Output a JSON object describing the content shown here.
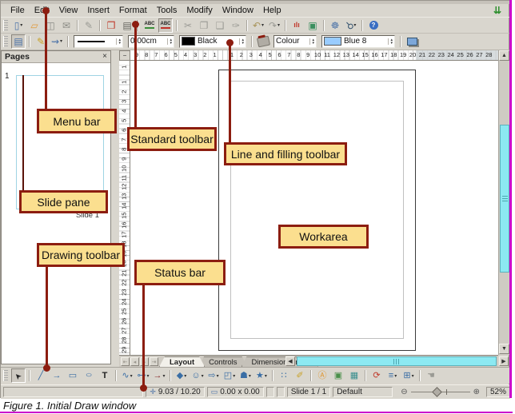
{
  "colors": {
    "callout_fill": "#fbdf8f",
    "callout_border": "#8c1d10",
    "scrollbar_thumb": "#8ce9f2",
    "figure_border": "#cc00cc"
  },
  "menu_bar": {
    "items": [
      "File",
      "Edit",
      "View",
      "Insert",
      "Format",
      "Tools",
      "Modify",
      "Window",
      "Help"
    ],
    "update_icon_glyph": "⇊"
  },
  "standard_toolbar": {
    "icons": [
      {
        "name": "new-icon",
        "glyph": "▯",
        "color": "#4a72a8",
        "dd": true
      },
      {
        "name": "open-icon",
        "glyph": "▱",
        "color": "#e09a3a"
      },
      {
        "name": "save-icon",
        "glyph": "◫",
        "color": "#8a8a84"
      },
      {
        "name": "email-icon",
        "glyph": "✉",
        "color": "#8a8a84"
      },
      {
        "sep": true
      },
      {
        "name": "edit-file-icon",
        "glyph": "✎",
        "color": "#9a9a94"
      },
      {
        "sep": true
      },
      {
        "name": "export-pdf-icon",
        "glyph": "❒",
        "color": "#c0392b"
      },
      {
        "name": "print-icon",
        "glyph": "▤",
        "color": "#666660"
      },
      {
        "sep": true
      },
      {
        "name": "spellcheck-icon",
        "cls": "abc abc1"
      },
      {
        "name": "autospellcheck-icon",
        "cls": "abc abc2",
        "pressed": true
      },
      {
        "sep": true
      },
      {
        "name": "cut-icon",
        "glyph": "✂",
        "color": "#9a9a94"
      },
      {
        "name": "copy-icon",
        "glyph": "❐",
        "color": "#9a9a94"
      },
      {
        "name": "paste-icon",
        "glyph": "❑",
        "color": "#9a9a94"
      },
      {
        "name": "format-paintbrush-icon",
        "glyph": "✑",
        "color": "#9a9a94"
      },
      {
        "sep": true
      },
      {
        "name": "undo-icon",
        "glyph": "↶",
        "color": "#a8945a",
        "dd": true
      },
      {
        "name": "redo-icon",
        "glyph": "↷",
        "color": "#9a9a94",
        "dd": true
      },
      {
        "sep": true
      },
      {
        "name": "chart-icon",
        "glyph": "ılı",
        "cls": "chart",
        "color": "#c0392b"
      },
      {
        "name": "gallery-icon",
        "glyph": "▣",
        "color": "#3a8f5f"
      },
      {
        "sep": true
      },
      {
        "name": "navigator-icon",
        "glyph": "☸",
        "color": "#4a72a8"
      },
      {
        "name": "zoom-icon",
        "glyph": "⚲",
        "cls": "rot",
        "color": "#33526e",
        "dd": true
      },
      {
        "sep": true
      },
      {
        "name": "help-icon",
        "cls": "helpico"
      }
    ]
  },
  "line_filling_toolbar": {
    "left_icons": [
      {
        "name": "styles-formatting-icon",
        "glyph": "▤",
        "color": "#4a72a8",
        "pressed": true
      },
      {
        "sep": true
      },
      {
        "name": "line-properties-icon",
        "glyph": "✎",
        "color": "#c9a227"
      },
      {
        "name": "arrow-style-icon",
        "glyph": "⇝",
        "color": "#4a72a8",
        "dd": true
      },
      {
        "sep": true
      }
    ],
    "line_width_value": "0.00cm",
    "line_color_name": "Black",
    "line_color_hex": "#000000",
    "fill_type": "Colour",
    "fill_color_name": "Blue 8",
    "fill_color_hex": "#99ccff"
  },
  "pages_panel": {
    "title": "Pages",
    "close_glyph": "×",
    "slide_number": "1",
    "slide_name": "Slide 1"
  },
  "rulers": {
    "horizontal_left": [
      "9",
      "8",
      "7",
      "6",
      "5",
      "4",
      "3",
      "2",
      "1"
    ],
    "horizontal_right": [
      "1",
      "2",
      "3",
      "4",
      "5",
      "6",
      "7",
      "8",
      "9",
      "10",
      "11",
      "12",
      "13",
      "14",
      "15",
      "16",
      "17",
      "18",
      "19",
      "20",
      "21",
      "22",
      "23",
      "24",
      "25",
      "26",
      "27",
      "28"
    ],
    "vertical_top": [
      "1"
    ],
    "vertical_main": [
      "1",
      "2",
      "3",
      "4",
      "5",
      "6",
      "7",
      "8",
      "9",
      "10",
      "11",
      "12",
      "13",
      "14",
      "15",
      "16",
      "17",
      "18",
      "19",
      "20",
      "21",
      "22",
      "23",
      "24",
      "25",
      "26",
      "27",
      "28",
      "29"
    ]
  },
  "tab_bar": {
    "nav": [
      {
        "name": "first-slide-button",
        "glyph": "⇤",
        "color": "#9a968e"
      },
      {
        "name": "prev-slide-button",
        "glyph": "◂",
        "color": "#9a968e"
      },
      {
        "name": "next-slide-button",
        "glyph": "▸",
        "color": "#9a968e"
      },
      {
        "name": "last-slide-button",
        "glyph": "⇥",
        "color": "#9a968e"
      }
    ],
    "tabs": [
      {
        "label": "Layout",
        "active": true
      },
      {
        "label": "Controls",
        "active": false
      },
      {
        "label": "Dimension Lines",
        "active": false
      }
    ]
  },
  "drawing_toolbar": {
    "icons": [
      {
        "name": "select-icon",
        "glyph": "➤",
        "cls": "rotm",
        "color": "#222222",
        "pressed": true
      },
      {
        "sep": true
      },
      {
        "name": "line-icon",
        "glyph": "╱",
        "color": "#3a6ea5"
      },
      {
        "name": "arrow-icon",
        "glyph": "→",
        "color": "#3a6ea5"
      },
      {
        "name": "rectangle-icon",
        "glyph": "▭",
        "color": "#3a6ea5"
      },
      {
        "name": "ellipse-icon",
        "glyph": "○",
        "cls": "ell",
        "color": "#3a6ea5"
      },
      {
        "name": "text-icon",
        "glyph": "T",
        "cls": "tbold",
        "color": "#222222"
      },
      {
        "sep": true
      },
      {
        "name": "curve-icon",
        "glyph": "∿",
        "color": "#3a6ea5",
        "dd": true
      },
      {
        "name": "connector-icon",
        "glyph": "⊶",
        "color": "#3a6ea5",
        "dd": true
      },
      {
        "name": "lines-arrows-icon",
        "glyph": "→",
        "color": "#8a2f2f",
        "dd": true
      },
      {
        "sep": true
      },
      {
        "name": "basic-shapes-icon",
        "glyph": "◆",
        "color": "#3a6ea5",
        "dd": true
      },
      {
        "name": "symbol-shapes-icon",
        "glyph": "☺",
        "color": "#3a6ea5",
        "dd": true
      },
      {
        "name": "block-arrows-icon",
        "glyph": "⇨",
        "color": "#3a6ea5",
        "dd": true
      },
      {
        "name": "flowchart-icon",
        "glyph": "◰",
        "color": "#3a6ea5",
        "dd": true
      },
      {
        "name": "callouts-icon",
        "glyph": "☗",
        "color": "#3a6ea5",
        "dd": true
      },
      {
        "name": "stars-icon",
        "glyph": "★",
        "color": "#3a6ea5",
        "dd": true
      },
      {
        "sep": true
      },
      {
        "name": "edit-points-icon",
        "glyph": "∷",
        "color": "#3a6ea5"
      },
      {
        "name": "glue-points-icon",
        "glyph": "✐",
        "color": "#c9a227"
      },
      {
        "sep": true
      },
      {
        "name": "fontwork-icon",
        "glyph": "Ⓐ",
        "color": "#e09a3a"
      },
      {
        "name": "from-file-icon",
        "glyph": "▣",
        "color": "#4a8f4a"
      },
      {
        "name": "gallery-icon-drawing",
        "glyph": "▦",
        "color": "#3a8f8f"
      },
      {
        "sep": true
      },
      {
        "name": "rotate-icon",
        "glyph": "⟳",
        "color": "#c0392b"
      },
      {
        "name": "alignment-icon",
        "glyph": "≡",
        "color": "#3a6ea5",
        "dd": true
      },
      {
        "name": "arrange-icon",
        "glyph": "⊞",
        "color": "#3a6ea5",
        "dd": true
      },
      {
        "sep": true
      },
      {
        "name": "interaction-icon",
        "glyph": "☚",
        "color": "#9a9a94"
      }
    ]
  },
  "status_bar": {
    "position_icon": "✛",
    "position": "9.03 / 10.20",
    "size_icon": "▭",
    "size": "0.00 x 0.00",
    "slide": "Slide 1 / 1",
    "style": "Default",
    "zoom_out_glyph": "⊖",
    "zoom_in_glyph": "⊕",
    "zoom_percent": "52%"
  },
  "callouts": {
    "menu_bar": "Menu bar",
    "standard_toolbar": "Standard toolbar",
    "line_filling": "Line and filling toolbar",
    "slide_pane": "Slide pane",
    "drawing_toolbar": "Drawing toolbar",
    "status_bar": "Status bar",
    "workarea": "Workarea"
  },
  "caption": "Figure 1. Initial Draw window"
}
